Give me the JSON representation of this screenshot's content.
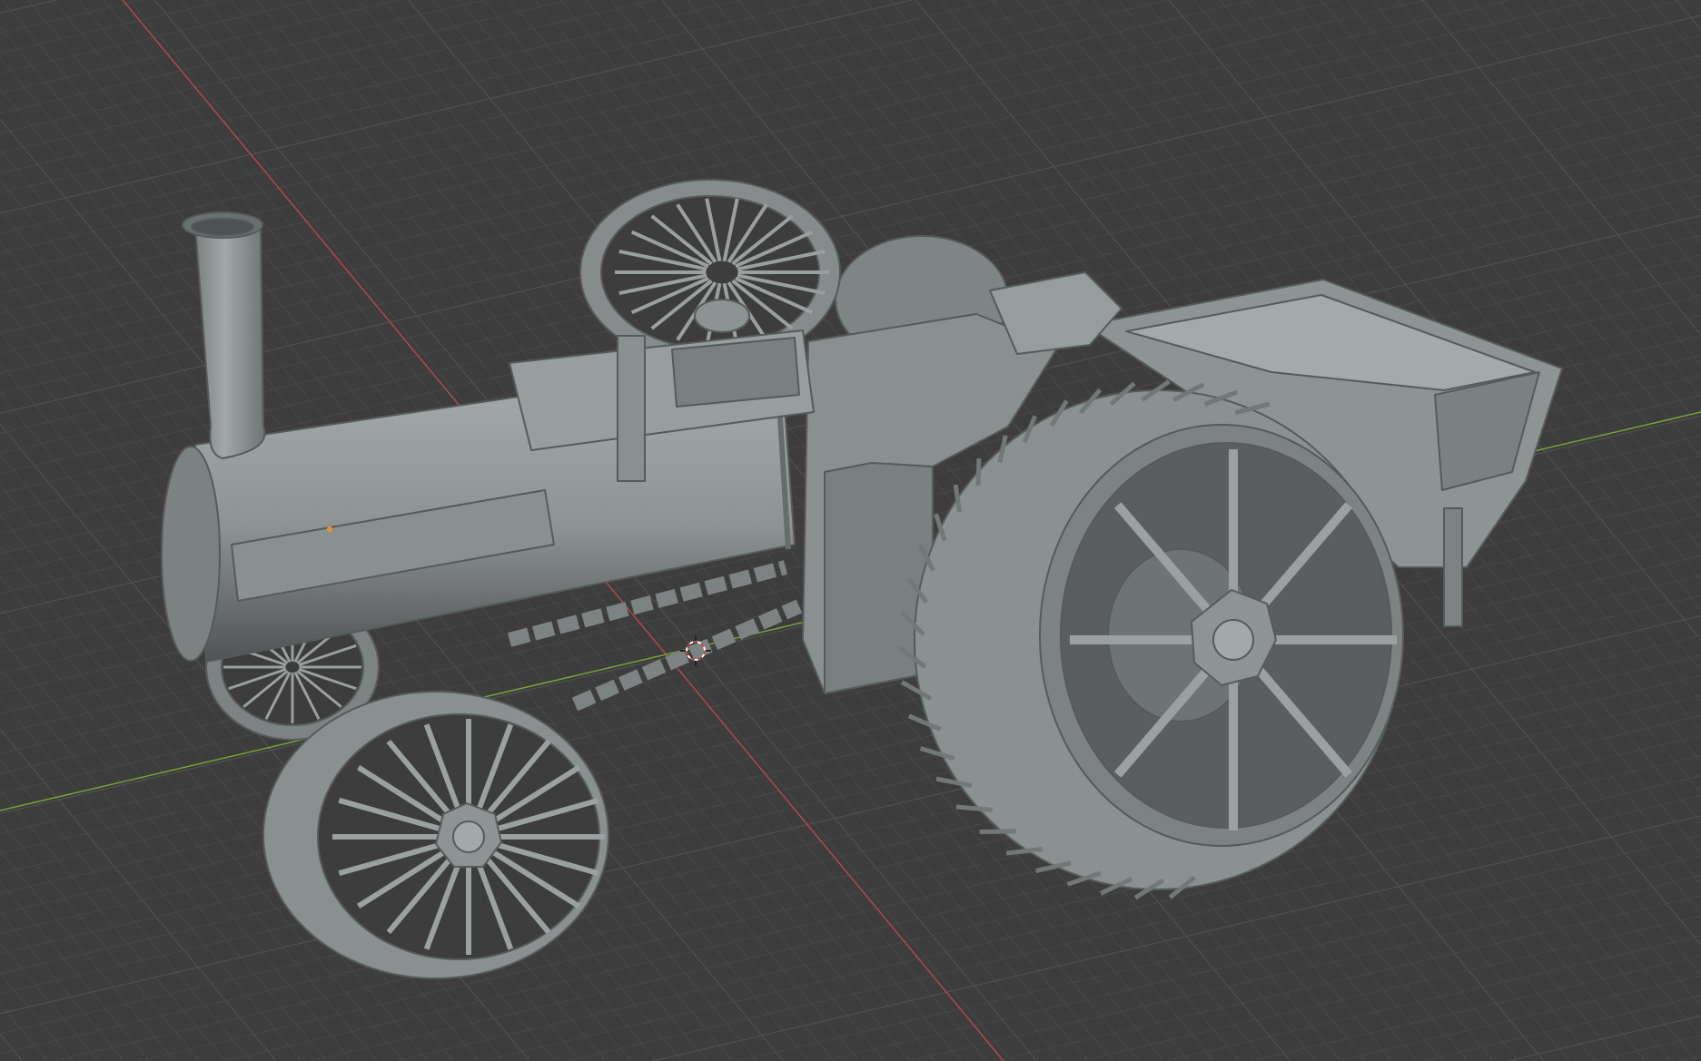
{
  "viewport": {
    "mode": "3d-viewport",
    "background_color": "#3d3d3d",
    "grid_color": "#4a4a4a",
    "x_axis_color": "#b4474e",
    "y_axis_color": "#7aa336",
    "model_color": "#8d9292",
    "cursor_icon": "3d-cursor-icon",
    "origin_icon": "object-origin-icon"
  }
}
